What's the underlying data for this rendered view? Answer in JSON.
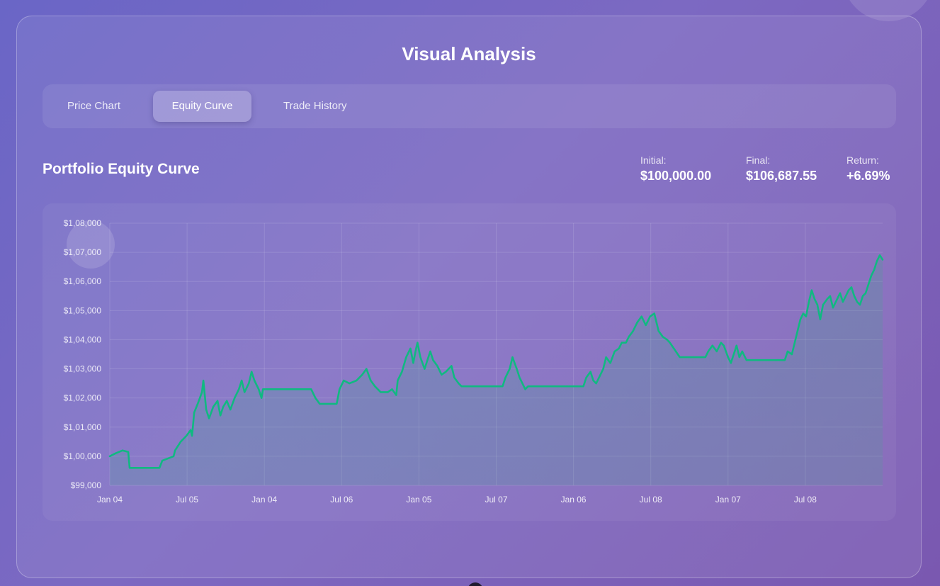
{
  "panel": {
    "title": "Visual Analysis"
  },
  "tabs": [
    {
      "label": "Price Chart",
      "active": false
    },
    {
      "label": "Equity Curve",
      "active": true
    },
    {
      "label": "Trade History",
      "active": false
    }
  ],
  "equity": {
    "title": "Portfolio Equity Curve",
    "initial_label": "Initial:",
    "initial_value": "$100,000.00",
    "final_label": "Final:",
    "final_value": "$106,687.55",
    "return_label": "Return:",
    "return_value": "+6.69%"
  },
  "colors": {
    "line": "#10b981",
    "grid": "rgba(255,255,255,0.13)",
    "tick_text": "rgba(255,255,255,0.85)"
  },
  "chart_data": {
    "type": "area",
    "title": "",
    "xlabel": "",
    "ylabel": "",
    "ylim": [
      99000,
      108000
    ],
    "y_ticks": [
      {
        "value": 108000,
        "label": "$1,08,000"
      },
      {
        "value": 107000,
        "label": "$1,07,000"
      },
      {
        "value": 106000,
        "label": "$1,06,000"
      },
      {
        "value": 105000,
        "label": "$1,05,000"
      },
      {
        "value": 104000,
        "label": "$1,04,000"
      },
      {
        "value": 103000,
        "label": "$1,03,000"
      },
      {
        "value": 102000,
        "label": "$1,02,000"
      },
      {
        "value": 101000,
        "label": "$1,01,000"
      },
      {
        "value": 100000,
        "label": "$1,00,000"
      },
      {
        "value": 99000,
        "label": "$99,000"
      }
    ],
    "x_tick_labels": [
      "Jan 04",
      "Jul 05",
      "Jan 04",
      "Jul 06",
      "Jan 05",
      "Jul 07",
      "Jan 06",
      "Jul 08",
      "Jan 07",
      "Jul 08"
    ],
    "grid": true,
    "legend": "none",
    "series": [
      {
        "values": [
          [
            0,
            100000
          ],
          [
            8,
            100100
          ],
          [
            18,
            100200
          ],
          [
            26,
            100150
          ],
          [
            28,
            99600
          ],
          [
            45,
            99600
          ],
          [
            70,
            99600
          ],
          [
            74,
            99850
          ],
          [
            90,
            100000
          ],
          [
            92,
            100200
          ],
          [
            100,
            100500
          ],
          [
            108,
            100700
          ],
          [
            114,
            100900
          ],
          [
            116,
            100700
          ],
          [
            119,
            101500
          ],
          [
            124,
            101800
          ],
          [
            130,
            102200
          ],
          [
            132,
            102600
          ],
          [
            136,
            101600
          ],
          [
            140,
            101300
          ],
          [
            146,
            101700
          ],
          [
            152,
            101900
          ],
          [
            156,
            101400
          ],
          [
            160,
            101700
          ],
          [
            165,
            101900
          ],
          [
            170,
            101600
          ],
          [
            176,
            102000
          ],
          [
            182,
            102300
          ],
          [
            186,
            102600
          ],
          [
            190,
            102200
          ],
          [
            196,
            102500
          ],
          [
            200,
            102900
          ],
          [
            204,
            102600
          ],
          [
            210,
            102300
          ],
          [
            214,
            102000
          ],
          [
            216,
            102300
          ],
          [
            234,
            102300
          ],
          [
            270,
            102300
          ],
          [
            284,
            102300
          ],
          [
            290,
            102000
          ],
          [
            296,
            101800
          ],
          [
            306,
            101800
          ],
          [
            320,
            101800
          ],
          [
            324,
            102300
          ],
          [
            330,
            102600
          ],
          [
            338,
            102500
          ],
          [
            348,
            102600
          ],
          [
            356,
            102800
          ],
          [
            362,
            103000
          ],
          [
            368,
            102600
          ],
          [
            374,
            102400
          ],
          [
            382,
            102200
          ],
          [
            392,
            102200
          ],
          [
            398,
            102300
          ],
          [
            404,
            102100
          ],
          [
            406,
            102600
          ],
          [
            412,
            102900
          ],
          [
            418,
            103400
          ],
          [
            424,
            103700
          ],
          [
            428,
            103200
          ],
          [
            432,
            103700
          ],
          [
            434,
            103900
          ],
          [
            438,
            103400
          ],
          [
            444,
            103000
          ],
          [
            448,
            103300
          ],
          [
            452,
            103600
          ],
          [
            456,
            103300
          ],
          [
            462,
            103100
          ],
          [
            468,
            102800
          ],
          [
            474,
            102900
          ],
          [
            482,
            103100
          ],
          [
            486,
            102700
          ],
          [
            492,
            102500
          ],
          [
            496,
            102400
          ],
          [
            520,
            102400
          ],
          [
            550,
            102400
          ],
          [
            554,
            102400
          ],
          [
            558,
            102700
          ],
          [
            564,
            103000
          ],
          [
            568,
            103400
          ],
          [
            574,
            103000
          ],
          [
            578,
            102700
          ],
          [
            582,
            102500
          ],
          [
            586,
            102300
          ],
          [
            590,
            102400
          ],
          [
            620,
            102400
          ],
          [
            660,
            102400
          ],
          [
            668,
            102400
          ],
          [
            672,
            102700
          ],
          [
            678,
            102900
          ],
          [
            682,
            102600
          ],
          [
            686,
            102500
          ],
          [
            690,
            102700
          ],
          [
            696,
            103000
          ],
          [
            700,
            103400
          ],
          [
            706,
            103200
          ],
          [
            712,
            103600
          ],
          [
            718,
            103700
          ],
          [
            722,
            103900
          ],
          [
            728,
            103900
          ],
          [
            732,
            104100
          ],
          [
            738,
            104300
          ],
          [
            744,
            104600
          ],
          [
            750,
            104800
          ],
          [
            756,
            104500
          ],
          [
            762,
            104800
          ],
          [
            768,
            104900
          ],
          [
            774,
            104300
          ],
          [
            780,
            104100
          ],
          [
            786,
            104000
          ],
          [
            790,
            103900
          ],
          [
            804,
            103400
          ],
          [
            840,
            103400
          ],
          [
            844,
            103600
          ],
          [
            850,
            103800
          ],
          [
            856,
            103600
          ],
          [
            862,
            103900
          ],
          [
            866,
            103800
          ],
          [
            872,
            103400
          ],
          [
            876,
            103200
          ],
          [
            880,
            103500
          ],
          [
            884,
            103800
          ],
          [
            888,
            103400
          ],
          [
            892,
            103600
          ],
          [
            898,
            103300
          ],
          [
            930,
            103300
          ],
          [
            952,
            103300
          ],
          [
            956,
            103600
          ],
          [
            962,
            103500
          ],
          [
            966,
            103900
          ],
          [
            970,
            104300
          ],
          [
            974,
            104700
          ],
          [
            978,
            104900
          ],
          [
            982,
            104800
          ],
          [
            986,
            105300
          ],
          [
            990,
            105700
          ],
          [
            994,
            105400
          ],
          [
            998,
            105200
          ],
          [
            1002,
            104700
          ],
          [
            1006,
            105200
          ],
          [
            1012,
            105400
          ],
          [
            1016,
            105500
          ],
          [
            1020,
            105100
          ],
          [
            1024,
            105300
          ],
          [
            1030,
            105600
          ],
          [
            1034,
            105300
          ],
          [
            1038,
            105500
          ],
          [
            1042,
            105700
          ],
          [
            1046,
            105800
          ],
          [
            1050,
            105500
          ],
          [
            1054,
            105300
          ],
          [
            1058,
            105200
          ],
          [
            1062,
            105500
          ],
          [
            1066,
            105600
          ],
          [
            1070,
            105900
          ],
          [
            1074,
            106200
          ],
          [
            1078,
            106400
          ],
          [
            1082,
            106700
          ],
          [
            1086,
            106900
          ],
          [
            1090,
            106750
          ]
        ]
      }
    ]
  }
}
